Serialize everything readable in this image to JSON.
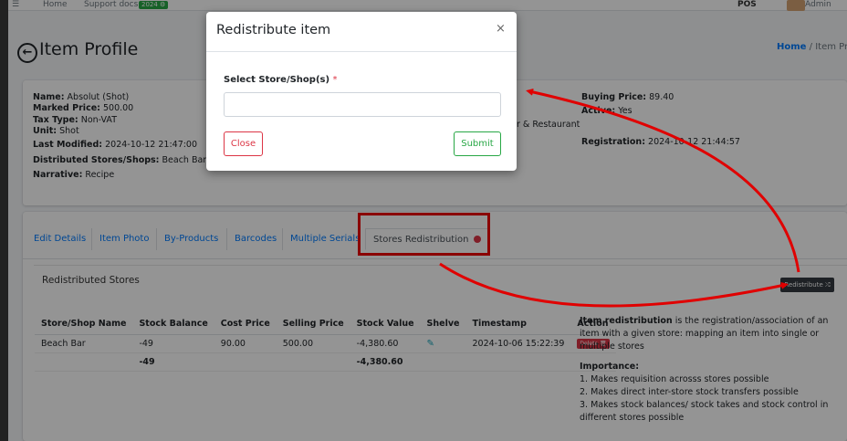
{
  "topnav": {
    "home": "Home",
    "support": "Support docs",
    "badge": "2024 ⚙",
    "pos": "POS",
    "user": "Admin"
  },
  "header": {
    "title": "Item Profile",
    "crumb_home": "Home",
    "crumb_sep": "/",
    "crumb_current": "Item Pr"
  },
  "info": {
    "name_label": "Name:",
    "name": "Absolut (Shot)",
    "marked_label": "Marked Price:",
    "marked": "500.00",
    "tax_label": "Tax Type:",
    "tax": "Non-VAT",
    "unit_label": "Unit:",
    "unit": "Shot",
    "modified_label": "Last Modified:",
    "modified": "2024-10-12 21:47:00",
    "dist_label": "Distributed Stores/Shops:",
    "dist": "Beach Bar /",
    "narr_label": "Narrative:",
    "narr": "Recipe",
    "mid_text": "r & Restaurant",
    "buying_label": "Buying Price:",
    "buying": "89.40",
    "active_label": "Active:",
    "active": "Yes",
    "reg_label": "Registration:",
    "reg": "2024-10-12 21:44:57"
  },
  "tabs": [
    "Edit Details",
    "Item Photo",
    "By-Products",
    "Barcodes",
    "Multiple Serials",
    "Stores Redistribution"
  ],
  "section": {
    "title": "Redistributed Stores",
    "redistribute": "Redistribute ⤮"
  },
  "table": {
    "headers": [
      "Store/Shop Name",
      "Stock Balance",
      "Cost Price",
      "Selling Price",
      "Stock Value",
      "Shelve",
      "Timestamp",
      "Action"
    ],
    "row": {
      "store": "Beach Bar",
      "balance": "-49",
      "cost": "90.00",
      "selling": "500.00",
      "value": "-4,380.60",
      "shelve": "✎",
      "timestamp": "2024-10-06 15:22:39",
      "action": "Delete 🗑"
    },
    "total": {
      "balance": "-49",
      "value": "-4,380.60"
    }
  },
  "help": {
    "bold": "Item redistribution",
    "text": " is the registration/association of an item with a given store: mapping an item into single or multiple stores",
    "importance": "Importance:",
    "p1": "1. Makes requisition acrosss stores possible",
    "p2": "2. Makes direct inter-store stock transfers possible",
    "p3": "3. Makes stock balances/ stock takes and stock control in different stores possible"
  },
  "modal": {
    "title": "Redistribute item",
    "close_x": "×",
    "label": "Select Store/Shop(s)",
    "required": "*",
    "close": "Close",
    "submit": "Submit"
  },
  "colors": {
    "annotation": "#e00000",
    "primary": "#007bff",
    "success": "#28a745",
    "danger": "#dc3545"
  }
}
